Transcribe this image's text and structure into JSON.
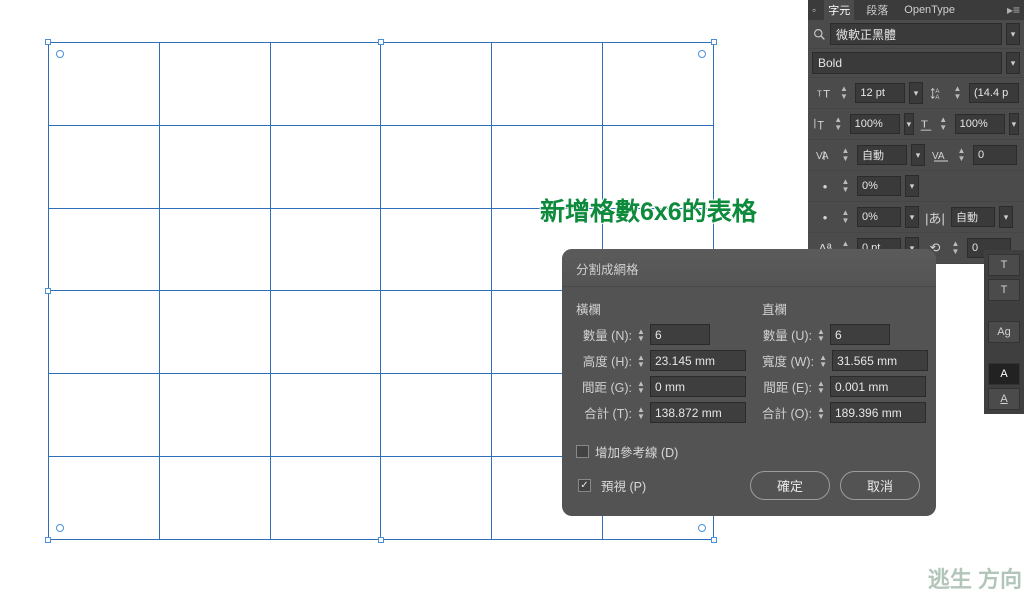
{
  "overlay_text": "新增格數6x6的表格",
  "dialog": {
    "title": "分割成網格",
    "rows_header": "橫欄",
    "cols_header": "直欄",
    "rows": {
      "count_label": "數量 (N):",
      "count_value": "6",
      "height_label": "高度 (H):",
      "height_value": "23.145 mm",
      "gutter_label": "間距 (G):",
      "gutter_value": "0 mm",
      "total_label": "合計 (T):",
      "total_value": "138.872 mm"
    },
    "cols": {
      "count_label": "數量 (U):",
      "count_value": "6",
      "width_label": "寬度 (W):",
      "width_value": "31.565 mm",
      "gutter_label": "間距 (E):",
      "gutter_value": "0.001 mm",
      "total_label": "合計 (O):",
      "total_value": "189.396 mm"
    },
    "add_guides_label": "增加參考線 (D)",
    "add_guides_checked": false,
    "preview_label": "預視 (P)",
    "preview_checked": true,
    "ok_label": "確定",
    "cancel_label": "取消"
  },
  "char_panel": {
    "tab_char": "字元",
    "tab_para": "段落",
    "tab_ot": "OpenType",
    "font_family": "微軟正黑體",
    "font_style": "Bold",
    "font_size": "12 pt",
    "leading": "(14.4 p",
    "hscale": "100%",
    "vscale": "100%",
    "kerning": "自動",
    "tracking": "0",
    "baseline_shift": "0%",
    "rotation": "0%",
    "aki_left": "0 pt",
    "aki_auto": "自動",
    "aki_right": "0"
  },
  "side_labels": {
    "glyph": "Ag",
    "a_outline": "A",
    "a_fill": "A",
    "t1": "T",
    "t2": "T"
  },
  "watermark": "逃生\n方向"
}
